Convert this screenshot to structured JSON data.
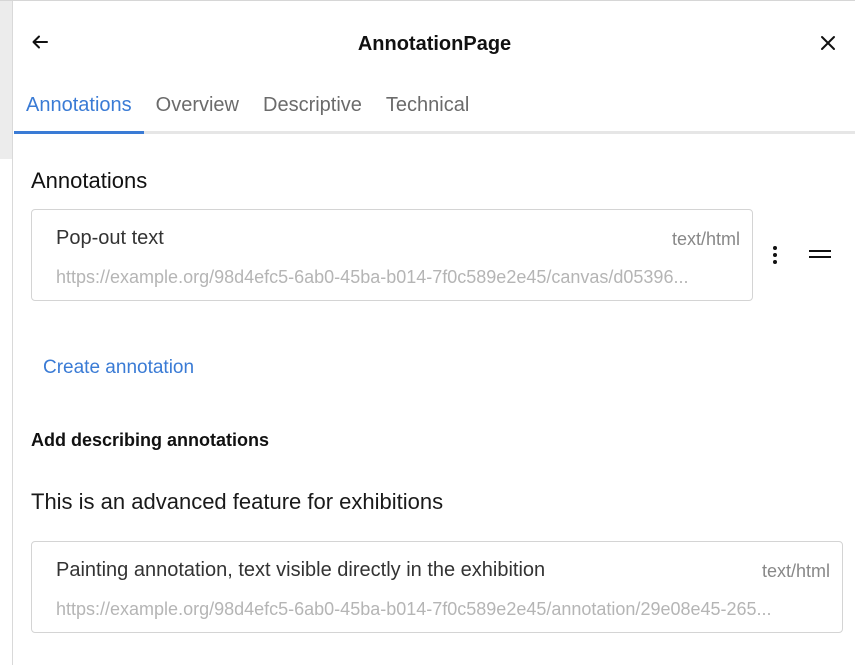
{
  "header": {
    "title": "AnnotationPage",
    "back_icon": "arrow-left-icon",
    "close_icon": "close-icon"
  },
  "tabs": [
    {
      "label": "Annotations",
      "active": true
    },
    {
      "label": "Overview",
      "active": false
    },
    {
      "label": "Descriptive",
      "active": false
    },
    {
      "label": "Technical",
      "active": false
    }
  ],
  "annotations_section": {
    "title": "Annotations",
    "items": [
      {
        "label": "Pop-out text",
        "type": "text/html",
        "url": "https://example.org/98d4efc5-6ab0-45ba-b014-7f0c589e2e45/canvas/d05396..."
      }
    ],
    "create_label": "Create annotation"
  },
  "describing_section": {
    "title": "Add describing annotations",
    "description": "This is an advanced feature for exhibitions",
    "items": [
      {
        "label": "Painting annotation, text visible directly in the exhibition",
        "type": "text/html",
        "url": "https://example.org/98d4efc5-6ab0-45ba-b014-7f0c589e2e45/annotation/29e08e45-265..."
      }
    ]
  },
  "colors": {
    "accent": "#3a7bd5",
    "border": "#d4d4d4",
    "muted_text": "#888888"
  }
}
